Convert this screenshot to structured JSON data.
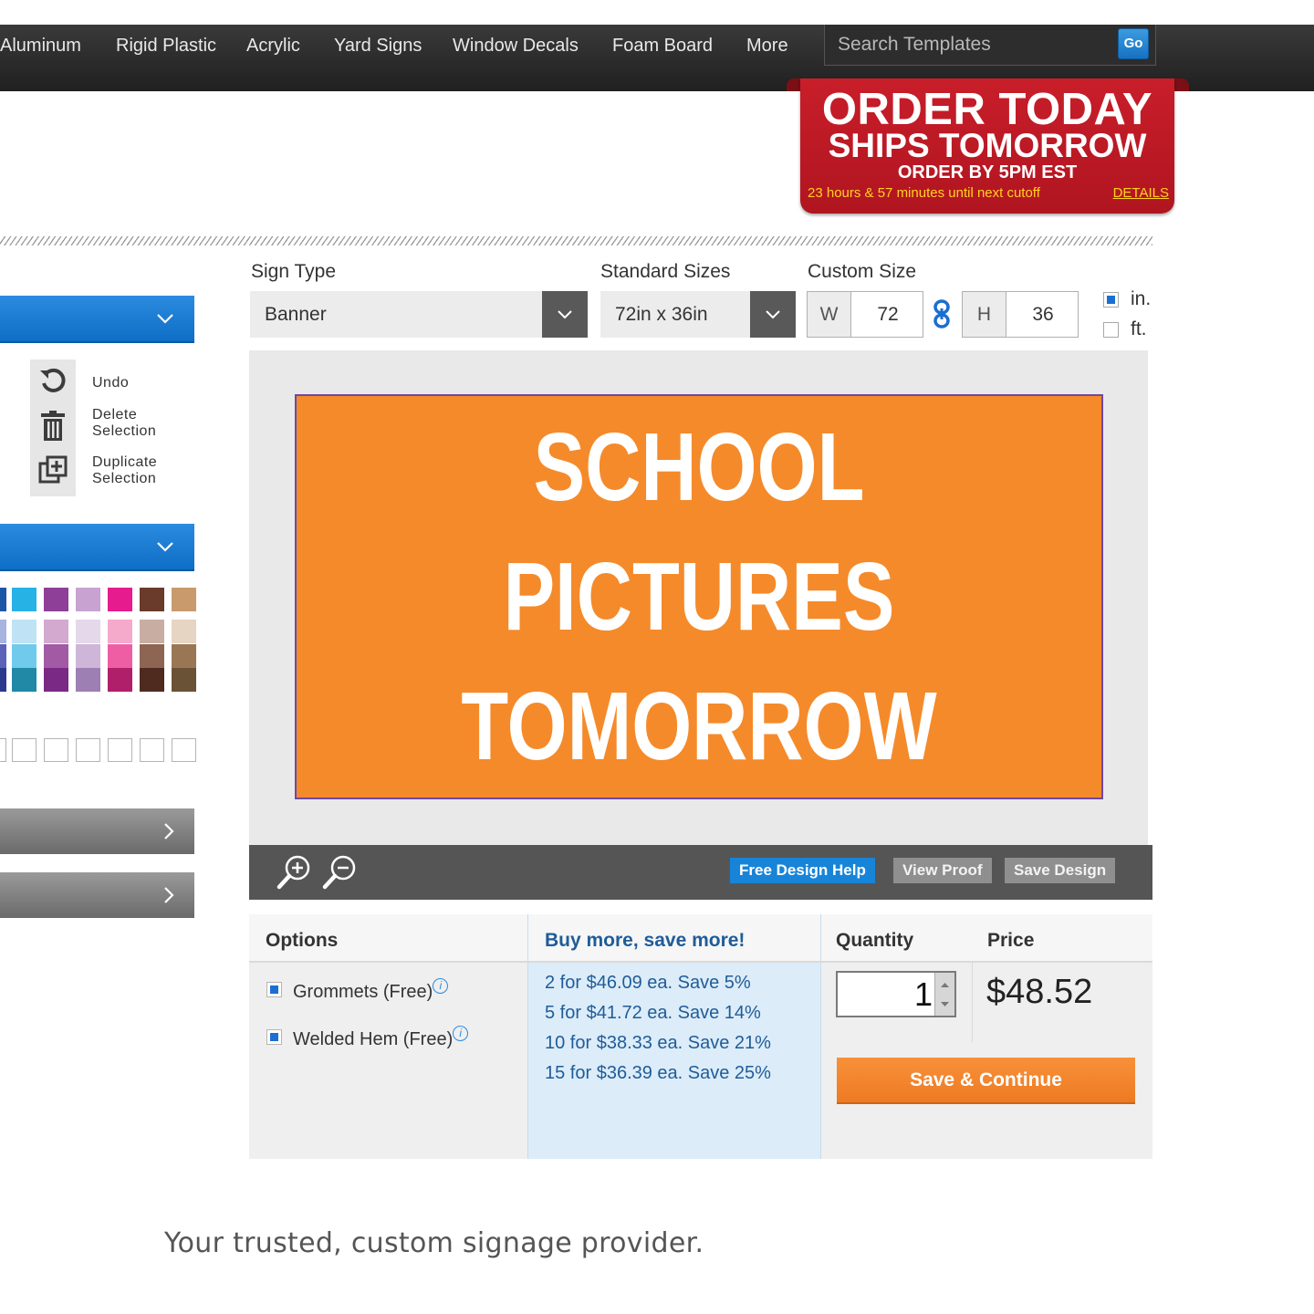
{
  "nav": {
    "items": [
      "Aluminum",
      "Rigid Plastic",
      "Acrylic",
      "Yard Signs",
      "Window Decals",
      "Foam Board",
      "More"
    ],
    "search_placeholder": "Search Templates",
    "go_label": "Go"
  },
  "promo": {
    "line1": "ORDER TODAY",
    "line2": "SHIPS TOMORROW",
    "line3": "ORDER BY 5PM EST",
    "countdown": "23 hours & 57 minutes until next cutoff",
    "details_link": "DETAILS",
    "color": "#c81e2a"
  },
  "tools": {
    "undo": "Undo",
    "delete_line1": "Delete",
    "delete_line2": "Selection",
    "duplicate_line1": "Duplicate",
    "duplicate_line2": "Selection",
    "icons": [
      "undo-icon",
      "trash-icon",
      "duplicate-icon"
    ]
  },
  "swatches": [
    [
      "#1f55a6",
      "#27b2e6",
      "#8e3f98",
      "#c8a2d1",
      "#e61b8d",
      "#6a3a2b",
      "#c89a6c"
    ],
    [
      "#a9b3e0",
      "#bfe3f5",
      "#d4a9cf",
      "#e6d8eb",
      "#f5aacb",
      "#c8aea2",
      "#e6d5c2"
    ],
    [
      "#5a63b8",
      "#6fcaec",
      "#a25aa5",
      "#cdb6d8",
      "#ee5ea5",
      "#8e6452",
      "#9a7754"
    ],
    [
      "#2b3a8c",
      "#2189a6",
      "#7a2985",
      "#9d7fb4",
      "#b0206a",
      "#4e2a1f",
      "#6a5236"
    ]
  ],
  "sign": {
    "sign_type_label": "Sign Type",
    "sign_type_value": "Banner",
    "standard_sizes_label": "Standard Sizes",
    "standard_size_value": "72in x 36in",
    "custom_size_label": "Custom Size",
    "width_key": "W",
    "width_value": "72",
    "height_key": "H",
    "height_value": "36",
    "unit_in": "in.",
    "unit_ft": "ft.",
    "unit_selected": "in."
  },
  "banner": {
    "line1": "SCHOOL",
    "line2": "PICTURES",
    "line3": "TOMORROW",
    "background": "#f58a2a",
    "text_color": "#ffffff"
  },
  "canvas_toolbar": {
    "free_design_help": "Free Design Help",
    "view_proof": "View Proof",
    "save_design": "Save Design"
  },
  "order": {
    "options_header": "Options",
    "buy_more_header": "Buy more, save more!",
    "quantity_header": "Quantity",
    "price_header": "Price",
    "options": [
      {
        "label": "Grommets (Free)",
        "checked": true
      },
      {
        "label": "Welded Hem (Free)",
        "checked": true
      }
    ],
    "tiers": [
      "2 for $46.09 ea. Save 5%",
      "5 for $41.72 ea. Save 14%",
      "10 for $38.33 ea. Save 21%",
      "15 for $36.39 ea. Save 25%"
    ],
    "quantity": "1",
    "price": "$48.52",
    "save_continue": "Save & Continue"
  },
  "footer": {
    "tagline": "Your trusted, custom signage provider."
  }
}
